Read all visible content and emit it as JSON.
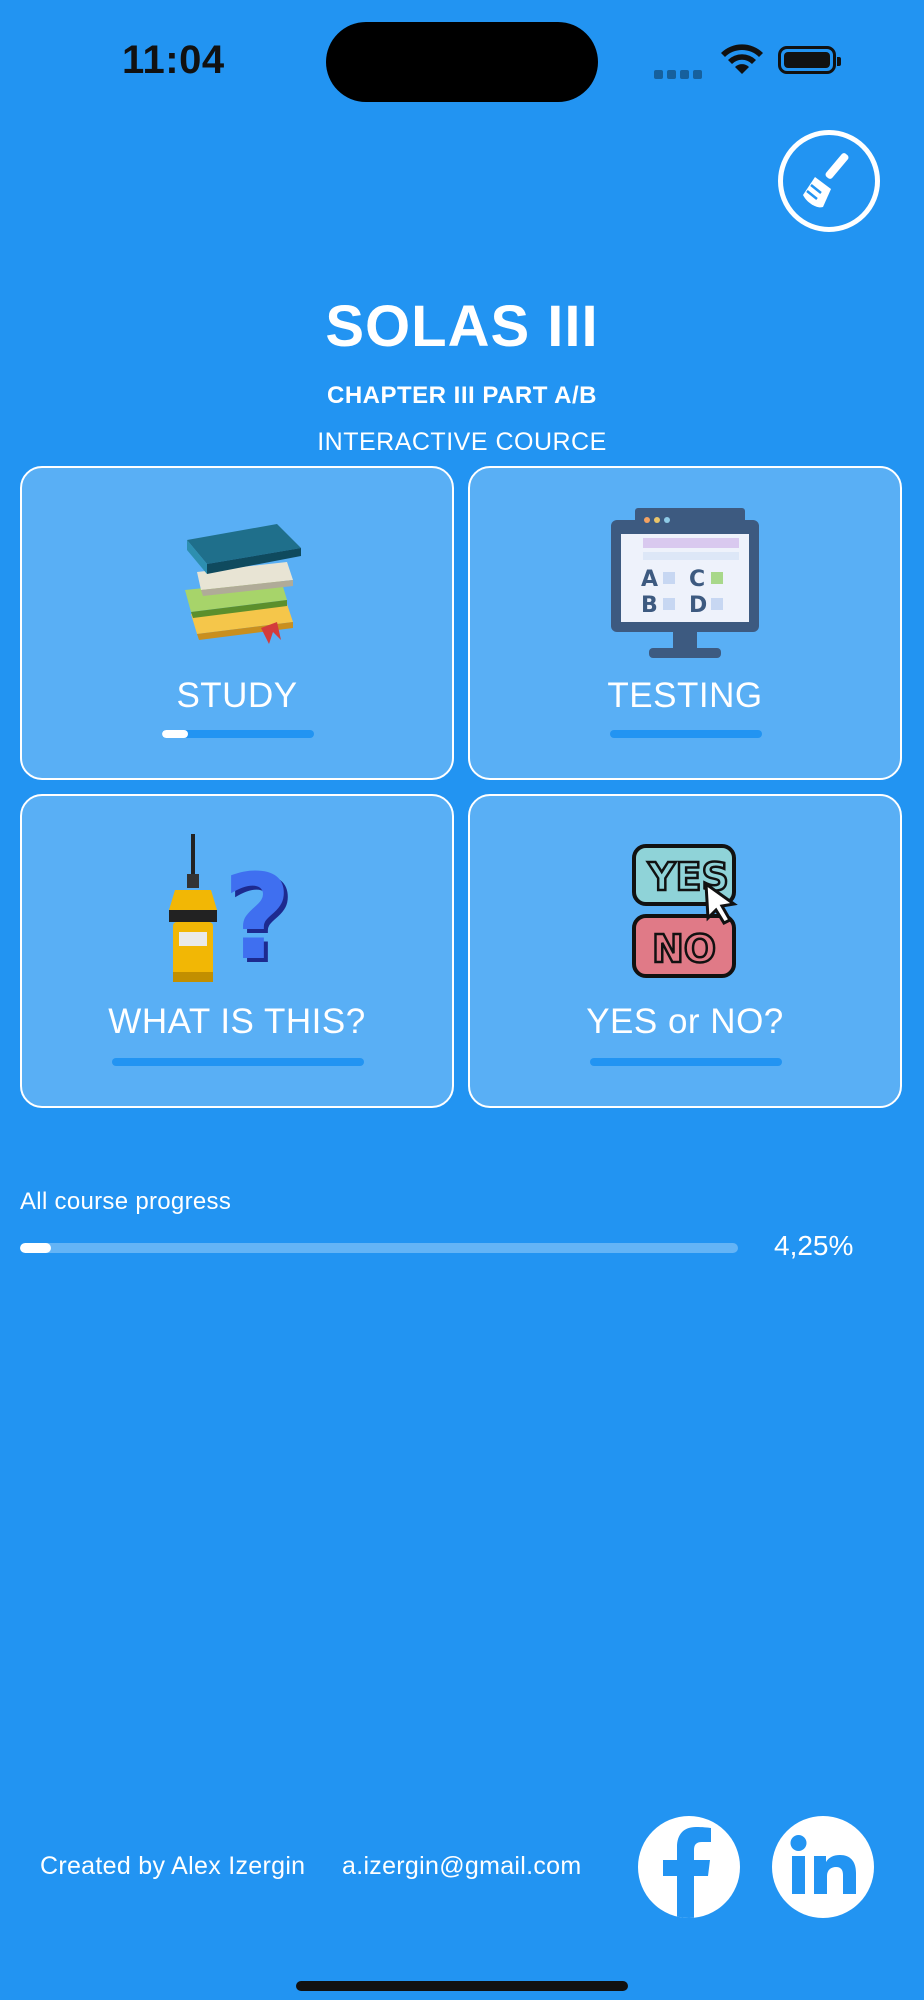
{
  "status_bar": {
    "time": "11:04"
  },
  "header": {
    "title": "SOLAS III",
    "subtitle": "CHAPTER III PART A/B",
    "tagline": "INTERACTIVE COURCE"
  },
  "toolbar": {
    "clean_icon": "broom-icon"
  },
  "cards": [
    {
      "label": "STUDY",
      "icon": "books-icon",
      "progress": 0.17
    },
    {
      "label": "TESTING",
      "icon": "monitor-quiz-icon",
      "progress": 0
    },
    {
      "label": "WHAT IS THIS?",
      "icon": "epirb-question-icon",
      "progress": 0
    },
    {
      "label": "YES or NO?",
      "icon": "yes-no-icon",
      "progress": 0
    }
  ],
  "course_progress": {
    "label": "All course progress",
    "value_text": "4,25%",
    "value": 0.0425
  },
  "footer": {
    "credit": "Created by Alex Izergin",
    "email": "a.izergin@gmail.com",
    "social": [
      "facebook-icon",
      "linkedin-icon"
    ]
  },
  "colors": {
    "background": "#2294f2",
    "card_fill": "rgba(255,255,255,0.25)",
    "accent": "#ffffff"
  }
}
